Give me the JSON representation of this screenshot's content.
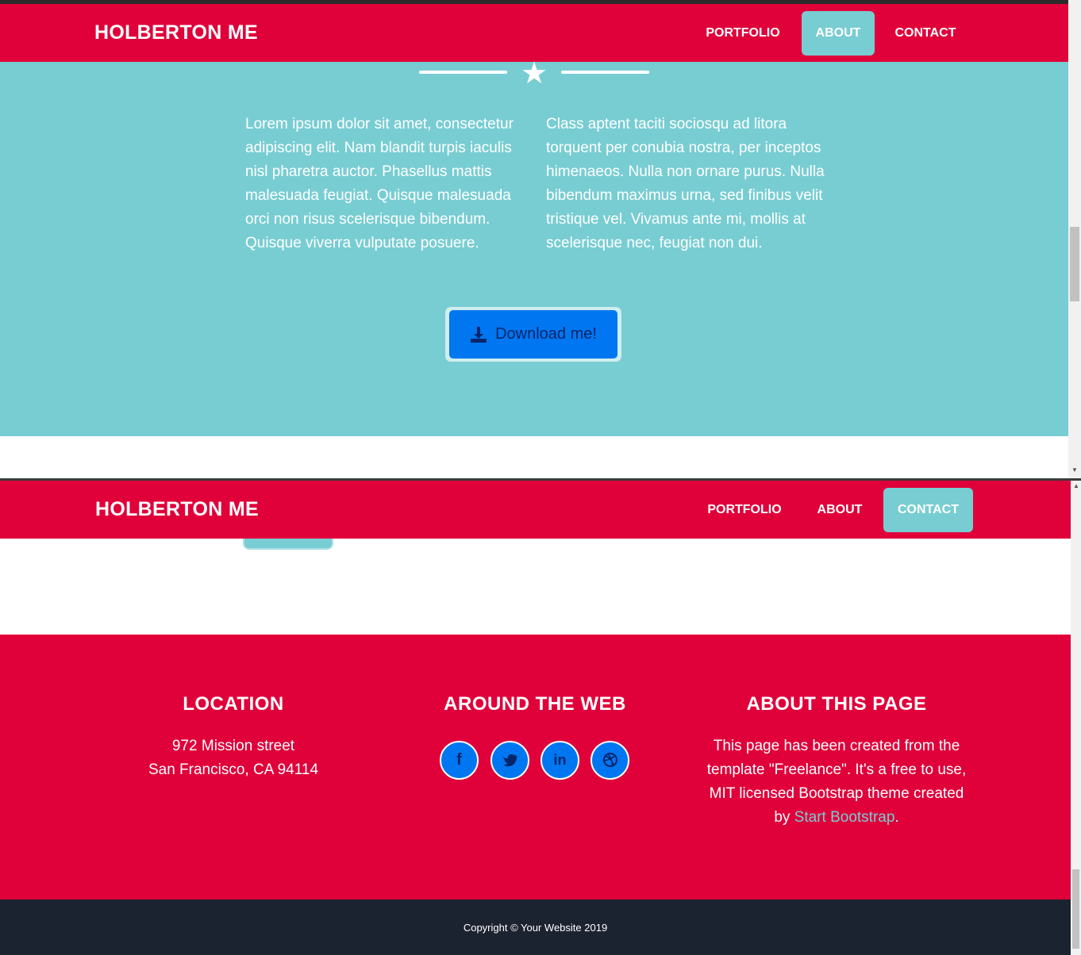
{
  "header": {
    "brand": "HOLBERTON ME",
    "nav": [
      "PORTFOLIO",
      "ABOUT",
      "CONTACT"
    ]
  },
  "about": {
    "para_left": "Lorem ipsum dolor sit amet, consectetur adipiscing elit. Nam blandit turpis iaculis nisl pharetra auctor. Phasellus mattis malesuada feugiat. Quisque malesuada orci non risus scelerisque bibendum. Quisque viverra vulputate posuere.",
    "para_right": "Class aptent taciti sociosqu ad litora torquent per conubia nostra, per inceptos himenaeos. Nulla non ornare purus. Nulla bibendum maximus urna, sed finibus velit tristique vel. Vivamus ante mi, mollis at scelerisque nec, feugiat non dui.",
    "download_label": "Download me!"
  },
  "footer": {
    "location_title": "LOCATION",
    "location_line1": "972 Mission street",
    "location_line2": "San Francisco, CA 94114",
    "web_title": "AROUND THE WEB",
    "social_icons": [
      "facebook-icon",
      "twitter-icon",
      "linkedin-icon",
      "dribbble-icon"
    ],
    "about_title": "ABOUT THIS PAGE",
    "about_text": "This page has been created from the template \"Freelance\". It's a free to use, MIT licensed Bootstrap theme created by",
    "about_link": "Start Bootstrap",
    "about_end": "."
  },
  "copyright": "Copyright © Your Website 2019",
  "colors": {
    "primary": "#e0003a",
    "accent": "#78cdd2",
    "button": "#0077f0",
    "dark": "#1c2330"
  }
}
